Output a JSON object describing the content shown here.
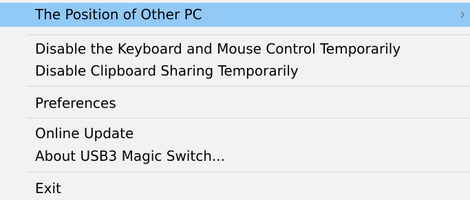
{
  "menu": {
    "items": [
      {
        "label": "The Position of Other PC",
        "has_submenu": true,
        "highlighted": true
      },
      {
        "label": "Disable the Keyboard and Mouse Control Temporarily"
      },
      {
        "label": "Disable Clipboard Sharing Temporarily"
      },
      {
        "label": "Preferences"
      },
      {
        "label": "Online Update"
      },
      {
        "label": "About USB3 Magic Switch..."
      },
      {
        "label": "Exit"
      }
    ]
  },
  "colors": {
    "menu_background": "#f2f2f2",
    "highlight": "#91c9f7",
    "separator": "#d7d7d7"
  },
  "icons": {
    "submenu_arrow": "chevron-right-icon"
  }
}
